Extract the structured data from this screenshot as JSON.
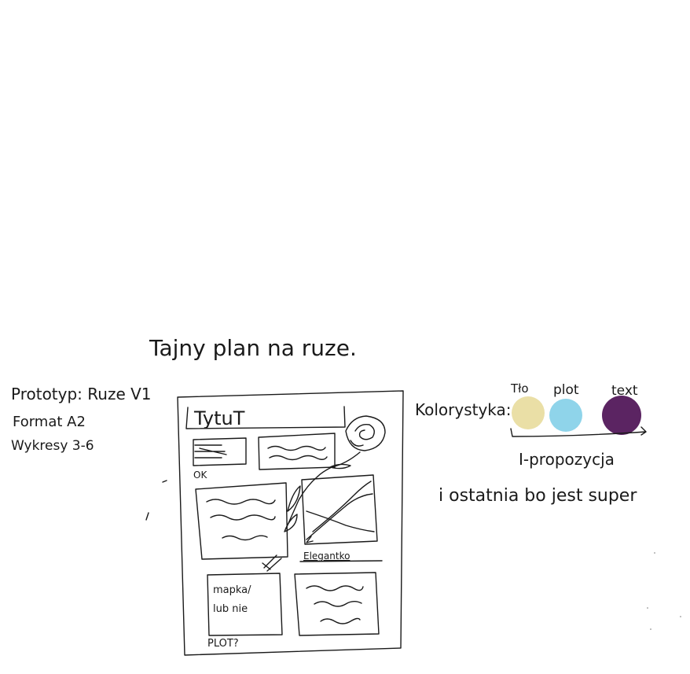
{
  "title": "Tajny plan na ruze.",
  "prototype_notes": [
    "Prototyp: Ruze V1",
    "Format A2",
    "Wykresy 3-6"
  ],
  "poster": {
    "heading": "TytuT",
    "ok_label": "OK",
    "elegant_label": "Elegantko",
    "map_label_line1": "mapka/",
    "map_label_line2": "lub nie",
    "plot_label": "PLOT?"
  },
  "palette": {
    "label": "Kolorystyka:",
    "swatches": [
      {
        "name": "Tło",
        "color": "#eadfa6"
      },
      {
        "name": "plot",
        "color": "#8fd4ea"
      },
      {
        "name": "text",
        "color": "#5b2462"
      }
    ],
    "proposal": "I-propozycja",
    "comment": "i ostatnia bo jest super"
  }
}
